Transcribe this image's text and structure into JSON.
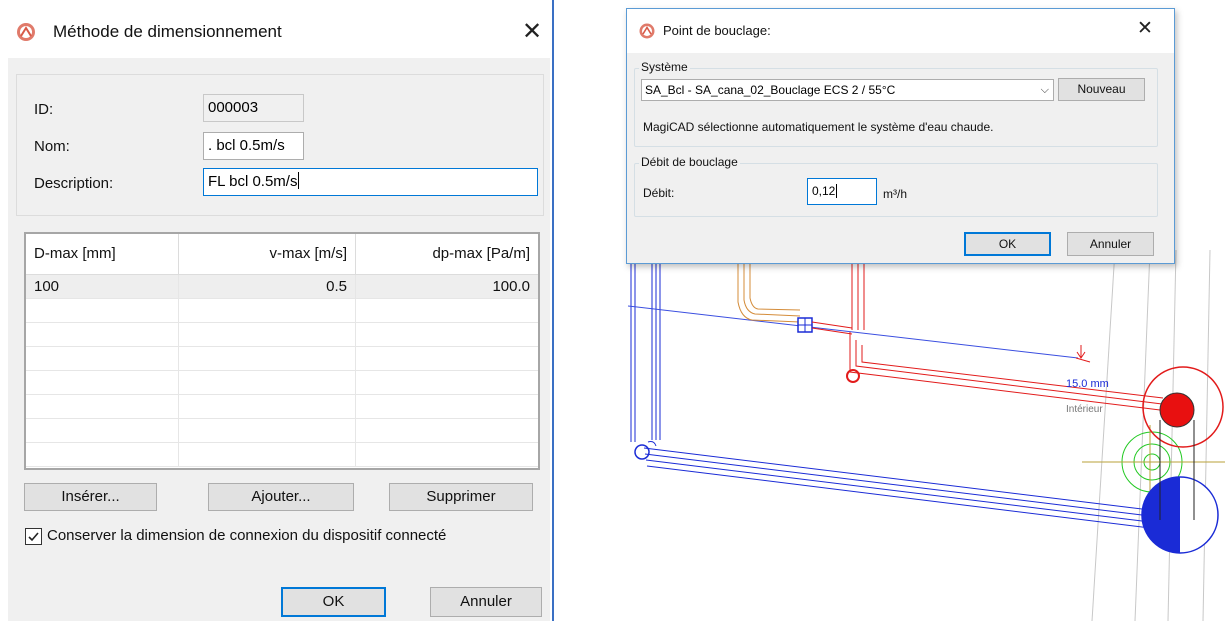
{
  "sizing_dialog": {
    "title": "Méthode de dimensionnement",
    "close_glyph": "✕",
    "id_label": "ID:",
    "id_value": "000003",
    "name_label": "Nom:",
    "name_value": ". bcl 0.5m/s",
    "description_label": "Description:",
    "description_value": "FL bcl 0.5m/s",
    "table": {
      "columns": [
        "D-max [mm]",
        "v-max [m/s]",
        "dp-max [Pa/m]"
      ],
      "rows": [
        [
          "100",
          "0.5",
          "100.0"
        ]
      ]
    },
    "buttons": {
      "insert": "Insérer...",
      "add": "Ajouter...",
      "delete": "Supprimer",
      "ok": "OK",
      "cancel": "Annuler"
    },
    "keep_connection_label": "Conserver la dimension de connexion du dispositif connecté",
    "keep_connection_checked": true
  },
  "loop_dialog": {
    "title": "Point de bouclage:",
    "close_glyph": "✕",
    "system_group_label": "Système",
    "system_value": "SA_Bcl - SA_cana_02_Bouclage ECS 2 / 55°C",
    "new_button": "Nouveau",
    "system_info": "MagiCAD sélectionne automatiquement le système d'eau chaude.",
    "flow_group_label": "Débit de bouclage",
    "flow_label": "Débit:",
    "flow_value": "0,12",
    "flow_unit": "m³/h",
    "ok_button": "OK",
    "cancel_button": "Annuler"
  },
  "cad": {
    "dimension_text": "15.0 mm",
    "location_text": "Intérieur"
  },
  "colors": {
    "accent": "#0078d7",
    "supply_red": "#e21b1b",
    "return_blue": "#1a2bd6",
    "pipe_orange": "#d48c3a",
    "connector_green": "#22c922"
  }
}
